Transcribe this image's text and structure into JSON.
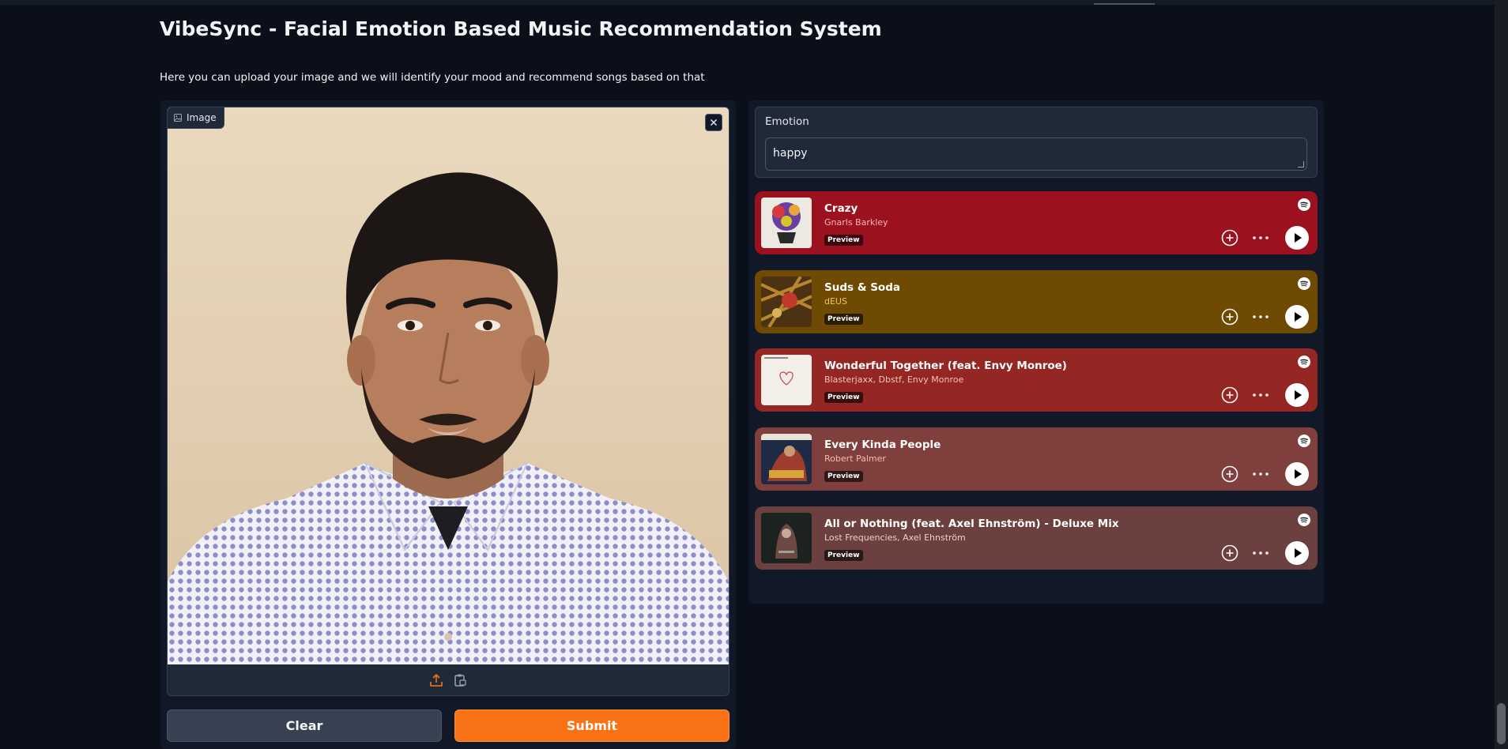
{
  "header": {
    "title": "VibeSync - Facial Emotion Based Music Recommendation System",
    "description": "Here you can upload your image and we will identify your mood and recommend songs based on that"
  },
  "image_input": {
    "label": "Image",
    "icons": [
      "image-icon",
      "close-icon",
      "upload-icon",
      "clipboard-icon"
    ],
    "accent": "#f97316"
  },
  "buttons": {
    "clear": "Clear",
    "submit": "Submit"
  },
  "emotion": {
    "label": "Emotion",
    "value": "happy"
  },
  "tracks": [
    {
      "title": "Crazy",
      "artist": "Gnarls Barkley",
      "badge": "Preview",
      "bg": "#9b111e",
      "artist_color": "#f4b8bf"
    },
    {
      "title": "Suds & Soda",
      "artist": "dEUS",
      "badge": "Preview",
      "bg": "#6f4a03",
      "artist_color": "#f0c45c"
    },
    {
      "title": "Wonderful Together (feat. Envy Monroe)",
      "artist": "Blasterjaxx, Dbstf, Envy Monroe",
      "badge": "Preview",
      "bg": "#942623",
      "artist_color": "#f5c3bc"
    },
    {
      "title": "Every Kinda People",
      "artist": "Robert Palmer",
      "badge": "Preview",
      "bg": "#7e3f3d",
      "artist_color": "#f2bcb6"
    },
    {
      "title": "All or Nothing (feat. Axel Ehnström) - Deluxe Mix",
      "artist": "Lost Frequencies, Axel Ehnström",
      "badge": "Preview",
      "bg": "#6b403e",
      "artist_color": "#ead1cd"
    }
  ]
}
